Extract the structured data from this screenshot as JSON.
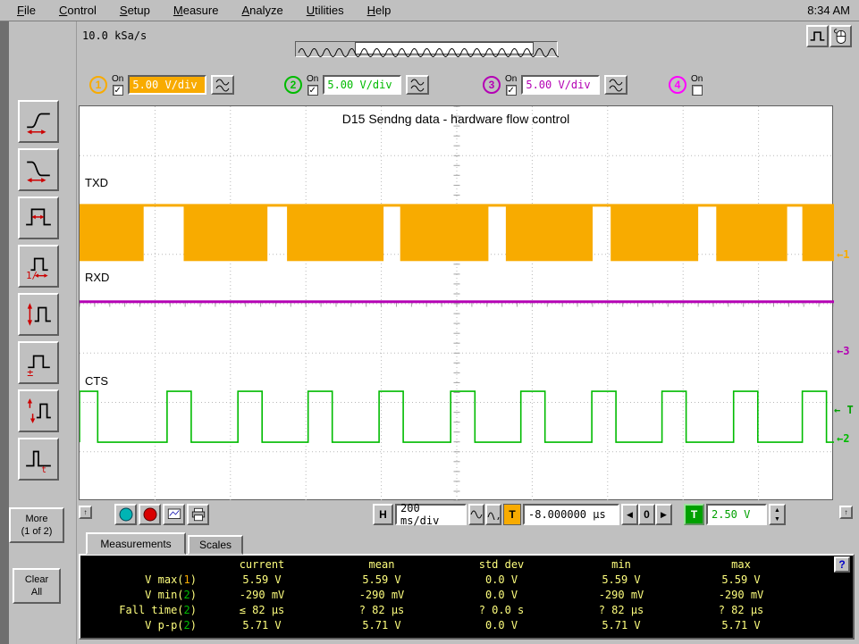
{
  "menu_bar": {
    "items": [
      {
        "label": "File"
      },
      {
        "label": "Control"
      },
      {
        "label": "Setup"
      },
      {
        "label": "Measure"
      },
      {
        "label": "Analyze"
      },
      {
        "label": "Utilities"
      },
      {
        "label": "Help"
      }
    ],
    "clock": "8:34 AM"
  },
  "toolbar": {
    "more_line1": "More",
    "more_line2": "(1 of 2)",
    "clear_line1": "Clear",
    "clear_line2": "All"
  },
  "acquisition": {
    "sample_rate": "10.0 kSa/s"
  },
  "channels": [
    {
      "num": "1",
      "on_label": "On",
      "checked": true,
      "scale": "5.00 V/div",
      "color": "#f8ab00"
    },
    {
      "num": "2",
      "on_label": "On",
      "checked": true,
      "scale": "5.00 V/div",
      "color": "#00bb00"
    },
    {
      "num": "3",
      "on_label": "On",
      "checked": true,
      "scale": "5.00 V/div",
      "color": "#b400b4"
    },
    {
      "num": "4",
      "on_label": "On",
      "checked": false,
      "color": "#ff00ff"
    }
  ],
  "display": {
    "annotation": "D15 Sendng data - hardware flow control",
    "traces": [
      {
        "label": "TXD"
      },
      {
        "label": "RXD"
      },
      {
        "label": "CTS"
      }
    ],
    "grid": {
      "h_divs": 10,
      "v_divs": 8
    },
    "waveform": {
      "txd": {
        "channel": 0,
        "top_frac": 0.252,
        "bottom_frac": 0.392,
        "bursts": [
          [
            0,
            0.085
          ],
          [
            0.138,
            0.249
          ],
          [
            0.275,
            0.403
          ],
          [
            0.425,
            0.542
          ],
          [
            0.565,
            0.68
          ],
          [
            0.704,
            0.82
          ],
          [
            0.844,
            0.938
          ],
          [
            0.958,
            1.0
          ]
        ]
      },
      "rxd": {
        "channel": 2,
        "level_frac": 0.495
      },
      "cts": {
        "channel": 1,
        "high_frac": 0.722,
        "low_frac": 0.851,
        "pulses": [
          [
            0,
            0.024
          ],
          [
            0.116,
            0.148
          ],
          [
            0.21,
            0.242
          ],
          [
            0.303,
            0.335
          ],
          [
            0.397,
            0.429
          ],
          [
            0.492,
            0.524
          ],
          [
            0.585,
            0.617
          ],
          [
            0.679,
            0.711
          ],
          [
            0.772,
            0.804
          ],
          [
            0.867,
            0.899
          ],
          [
            0.958,
            0.99
          ]
        ]
      }
    },
    "markers": [
      {
        "label": "1",
        "color": "#f8ab00"
      },
      {
        "label": "3",
        "color": "#b400b4"
      },
      {
        "label": "T",
        "color": "#00a000"
      },
      {
        "label": "2",
        "color": "#00bb00"
      }
    ]
  },
  "horizontal": {
    "h_button": "H",
    "scale": "200 ms/div",
    "marker_label": "T",
    "marker_color": "#f8ab00",
    "position": "-8.000000 µs",
    "zero": "0"
  },
  "trigger": {
    "t_button": "T",
    "level": "2.50 V",
    "color": "#00a000"
  },
  "controls": {
    "run_color": "#00b4b4",
    "stop_color": "#d80000"
  },
  "tabs": [
    {
      "label": "Measurements"
    },
    {
      "label": "Scales"
    }
  ],
  "measurements": {
    "headers": [
      "current",
      "mean",
      "std dev",
      "min",
      "max"
    ],
    "rows": [
      {
        "label_pre": "V max(",
        "ch": "1",
        "label_post": ")",
        "values": [
          "5.59 V",
          "5.59 V",
          "0.0 V",
          "5.59 V",
          "5.59 V"
        ]
      },
      {
        "label_pre": "V min(",
        "ch": "2",
        "label_post": ")",
        "values": [
          "-290 mV",
          "-290 mV",
          "0.0 V",
          "-290 mV",
          "-290 mV"
        ]
      },
      {
        "label_pre": "Fall time(",
        "ch": "2",
        "label_post": ")",
        "values": [
          "≤ 82 µs",
          "? 82 µs",
          "? 0.0 s",
          "? 82 µs",
          "? 82 µs"
        ]
      },
      {
        "label_pre": "V p-p(",
        "ch": "2",
        "label_post": ")",
        "values": [
          "5.71 V",
          "5.71 V",
          "0.0 V",
          "5.71 V",
          "5.71 V"
        ]
      }
    ]
  },
  "icons": {
    "left_arrow": "◀",
    "right_arrow": "▶",
    "up_arrow": "↑",
    "spin_up": "▲",
    "spin_down": "▼",
    "marker_arrow": "←",
    "help": "?"
  }
}
